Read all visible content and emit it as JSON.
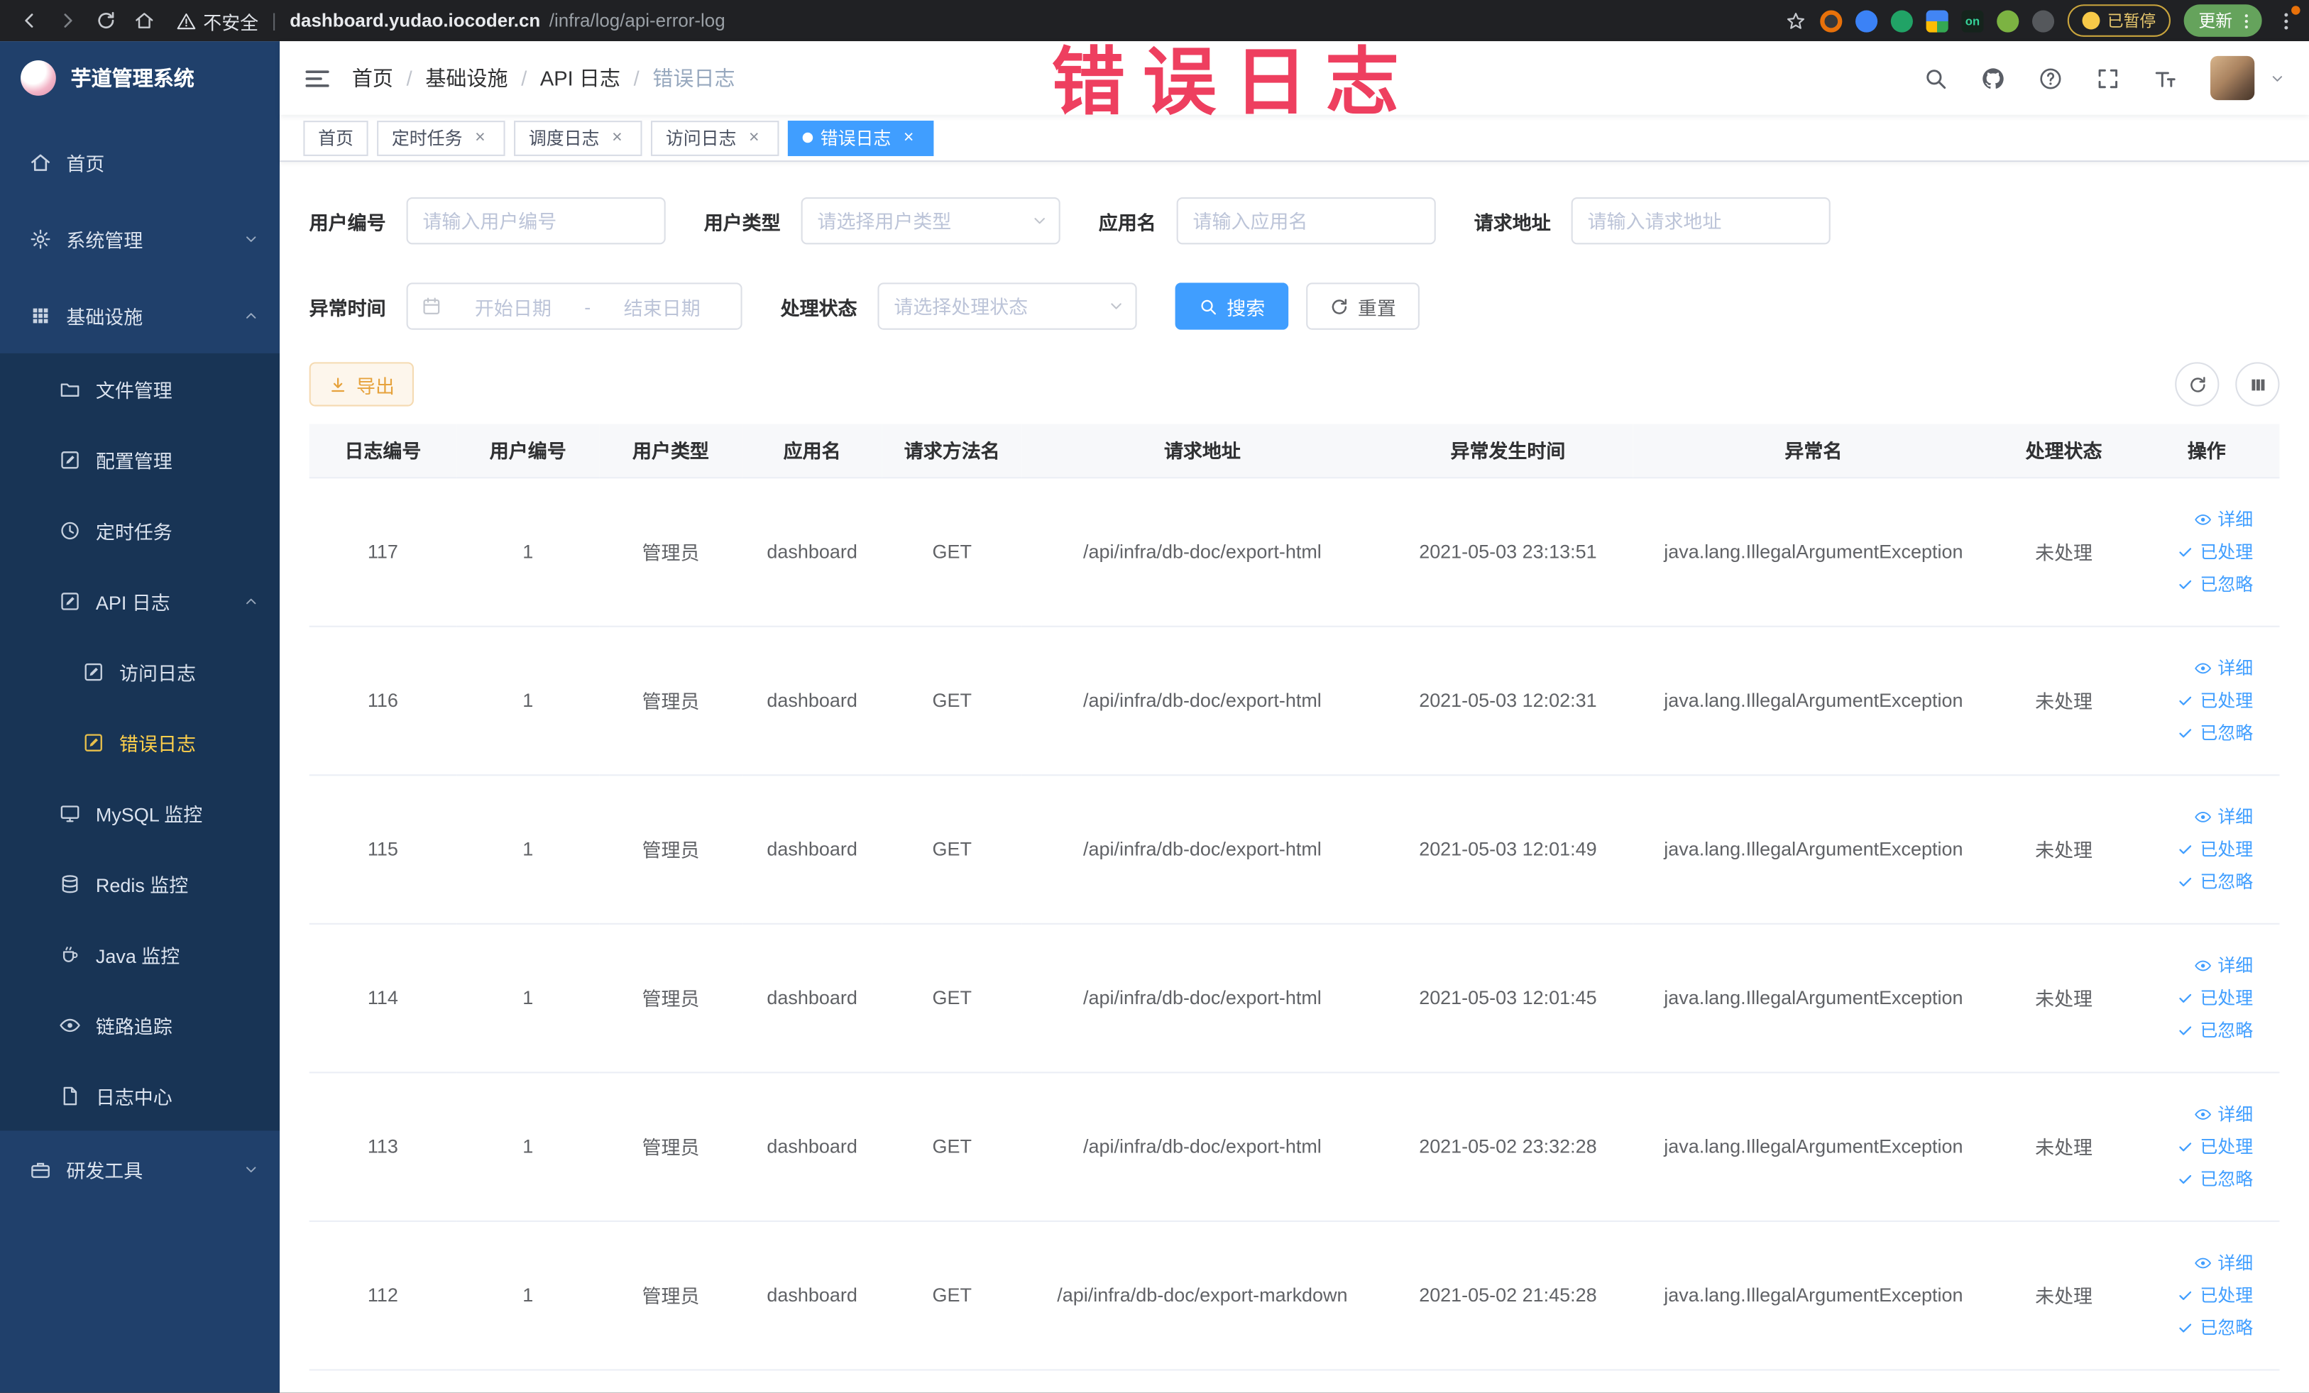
{
  "colors": {
    "accent": "#409eff",
    "watermark": "#ee3f5f",
    "sidebar-bg": "#20406b",
    "sidebar-sub-bg": "#183455",
    "sidebar-text": "#dbe3ef",
    "sidebar-active": "#ffd04b",
    "chrome-bg": "#202124",
    "warning-text": "#e6a23c",
    "warning-bg": "#fdf6ec",
    "warning-border": "#f5dab1"
  },
  "icons": {
    "close": "×"
  },
  "browser": {
    "security_label": "不安全",
    "url_host": "dashboard.yudao.iocoder.cn",
    "url_path": "/infra/log/api-error-log",
    "extension_on_badge": "on",
    "paused_badge": "已暂停",
    "update_button": "更新"
  },
  "overlay": {
    "watermark": "错误日志"
  },
  "sidebar": {
    "title": "芋道管理系统",
    "home": "首页",
    "system": "系统管理",
    "infra": "基础设施",
    "file": "文件管理",
    "config": "配置管理",
    "job": "定时任务",
    "api_log": "API 日志",
    "access_log": "访问日志",
    "error_log": "错误日志",
    "mysql": "MySQL 监控",
    "redis": "Redis 监控",
    "java": "Java 监控",
    "trace": "链路追踪",
    "log_center": "日志中心",
    "dev_tools": "研发工具"
  },
  "breadcrumb": [
    "首页",
    "基础设施",
    "API 日志",
    "错误日志"
  ],
  "tabs": [
    {
      "label": "首页",
      "closable": false,
      "active": false
    },
    {
      "label": "定时任务",
      "closable": true,
      "active": false
    },
    {
      "label": "调度日志",
      "closable": true,
      "active": false
    },
    {
      "label": "访问日志",
      "closable": true,
      "active": false
    },
    {
      "label": "错误日志",
      "closable": true,
      "active": true
    }
  ],
  "filters": {
    "user_id_label": "用户编号",
    "user_id_placeholder": "请输入用户编号",
    "user_type_label": "用户类型",
    "user_type_placeholder": "请选择用户类型",
    "app_name_label": "应用名",
    "app_name_placeholder": "请输入应用名",
    "request_url_label": "请求地址",
    "request_url_placeholder": "请输入请求地址",
    "exception_time_label": "异常时间",
    "date_start_placeholder": "开始日期",
    "date_separator": "-",
    "date_end_placeholder": "结束日期",
    "process_status_label": "处理状态",
    "process_status_placeholder": "请选择处理状态",
    "search_button": "搜索",
    "reset_button": "重置"
  },
  "toolbar": {
    "export_button": "导出"
  },
  "table": {
    "columns": [
      "日志编号",
      "用户编号",
      "用户类型",
      "应用名",
      "请求方法名",
      "请求地址",
      "异常发生时间",
      "异常名",
      "处理状态",
      "操作"
    ],
    "actions": {
      "detail": "详细",
      "processed": "已处理",
      "ignored": "已忽略"
    },
    "rows": [
      {
        "id": "117",
        "user_id": "1",
        "user_type": "管理员",
        "app": "dashboard",
        "method": "GET",
        "url": "/api/infra/db-doc/export-html",
        "time": "2021-05-03 23:13:51",
        "exception": "java.lang.IllegalArgumentException",
        "status": "未处理"
      },
      {
        "id": "116",
        "user_id": "1",
        "user_type": "管理员",
        "app": "dashboard",
        "method": "GET",
        "url": "/api/infra/db-doc/export-html",
        "time": "2021-05-03 12:02:31",
        "exception": "java.lang.IllegalArgumentException",
        "status": "未处理"
      },
      {
        "id": "115",
        "user_id": "1",
        "user_type": "管理员",
        "app": "dashboard",
        "method": "GET",
        "url": "/api/infra/db-doc/export-html",
        "time": "2021-05-03 12:01:49",
        "exception": "java.lang.IllegalArgumentException",
        "status": "未处理"
      },
      {
        "id": "114",
        "user_id": "1",
        "user_type": "管理员",
        "app": "dashboard",
        "method": "GET",
        "url": "/api/infra/db-doc/export-html",
        "time": "2021-05-03 12:01:45",
        "exception": "java.lang.IllegalArgumentException",
        "status": "未处理"
      },
      {
        "id": "113",
        "user_id": "1",
        "user_type": "管理员",
        "app": "dashboard",
        "method": "GET",
        "url": "/api/infra/db-doc/export-html",
        "time": "2021-05-02 23:32:28",
        "exception": "java.lang.IllegalArgumentException",
        "status": "未处理"
      },
      {
        "id": "112",
        "user_id": "1",
        "user_type": "管理员",
        "app": "dashboard",
        "method": "GET",
        "url": "/api/infra/db-doc/export-markdown",
        "time": "2021-05-02 21:45:28",
        "exception": "java.lang.IllegalArgumentException",
        "status": "未处理"
      }
    ]
  }
}
